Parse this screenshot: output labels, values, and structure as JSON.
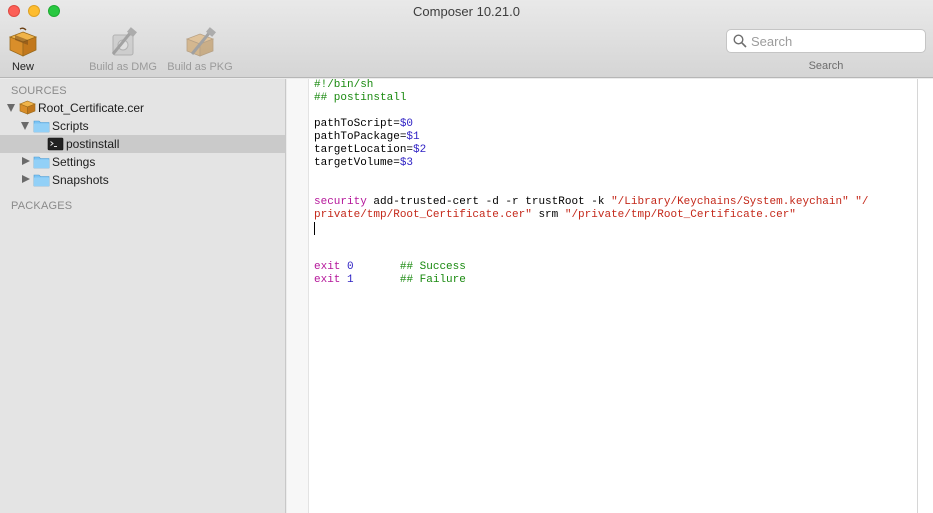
{
  "window": {
    "title": "Composer 10.21.0"
  },
  "toolbar": {
    "new_label": "New",
    "build_dmg_label": "Build as DMG",
    "build_pkg_label": "Build as PKG",
    "search_placeholder": "Search",
    "search_label": "Search"
  },
  "sidebar": {
    "sources_header": "SOURCES",
    "packages_header": "PACKAGES",
    "root_item": "Root_Certificate.cer",
    "scripts_item": "Scripts",
    "postinstall_item": "postinstall",
    "settings_item": "Settings",
    "snapshots_item": "Snapshots"
  },
  "editor": {
    "shebang": "#!/bin/sh",
    "header_comment": "## postinstall",
    "var1_name": "pathToScript=",
    "var1_value": "$0",
    "var2_name": "pathToPackage=",
    "var2_value": "$1",
    "var3_name": "targetLocation=",
    "var3_value": "$2",
    "var4_name": "targetVolume=",
    "var4_value": "$3",
    "cmd_keyword": "security",
    "cmd_args": " add-trusted-cert -d -r trustRoot -k ",
    "cmd_str1": "\"/Library/Keychains/System.keychain\"",
    "cmd_str2_start": " \"/",
    "cmd_str2_end": "private/tmp/Root_Certificate.cer\"",
    "cmd_srm": " srm ",
    "cmd_str3": "\"/private/tmp/Root_Certificate.cer\"",
    "exit_keyword": "exit",
    "exit0_value": "0",
    "exit0_comment": "## Success",
    "exit1_value": "1",
    "exit1_comment": "## Failure"
  },
  "colors": {
    "comment": "#1a8a10",
    "keyword": "#b5169a",
    "number": "#2f22c4",
    "string": "#c4281a",
    "selection": "#cacaca",
    "folder": "#7cc4f4"
  },
  "icons": {
    "new": "package-box-icon",
    "build_dmg": "disk-image-build-icon",
    "build_pkg": "package-build-icon",
    "search": "magnifier-icon",
    "root": "package-icon",
    "folder": "folder-icon",
    "script": "terminal-icon"
  }
}
